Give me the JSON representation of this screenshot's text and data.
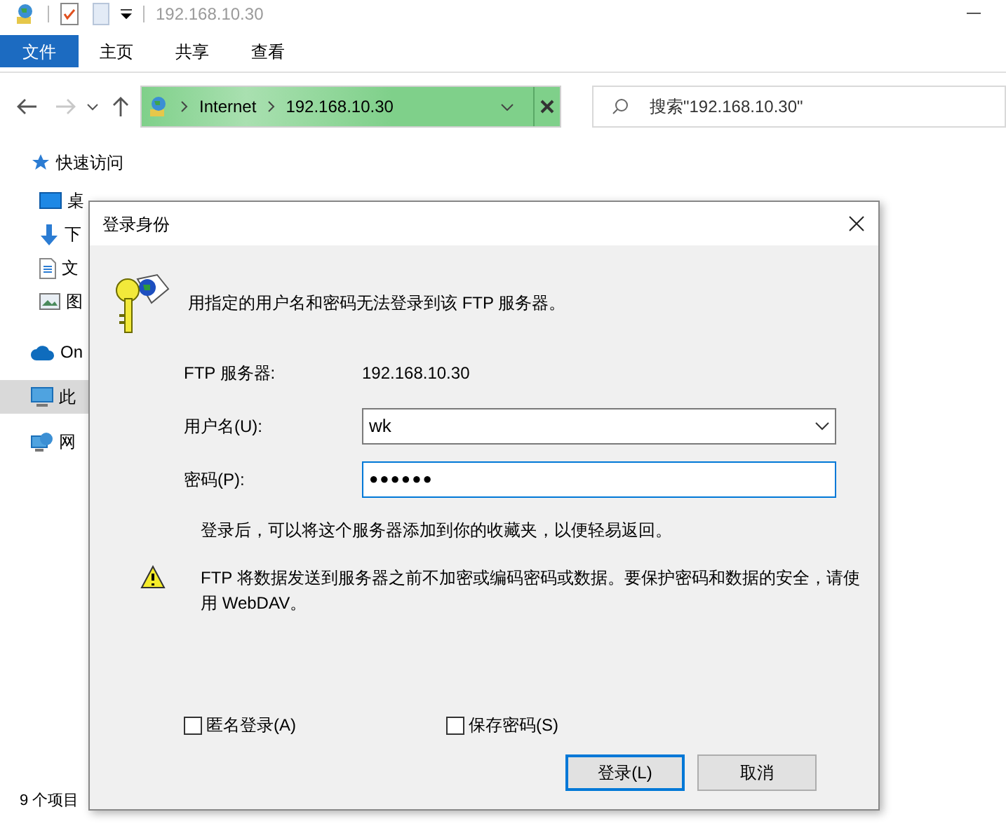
{
  "window": {
    "title": "192.168.10.30"
  },
  "ribbon_tabs": [
    {
      "label": "文件",
      "kind": "file"
    },
    {
      "label": "主页",
      "kind": "tab"
    },
    {
      "label": "共享",
      "kind": "tab"
    },
    {
      "label": "查看",
      "kind": "tab"
    }
  ],
  "address_bar": {
    "path": [
      "Internet",
      "192.168.10.30"
    ]
  },
  "search": {
    "placeholder": "搜索\"192.168.10.30\""
  },
  "sidebar": {
    "items": [
      {
        "label": "快速访问",
        "kind": "star",
        "selected": false
      },
      {
        "label": "桌",
        "kind": "desktop",
        "selected": false
      },
      {
        "label": "下",
        "kind": "download",
        "selected": false
      },
      {
        "label": "文",
        "kind": "document",
        "selected": false
      },
      {
        "label": "图",
        "kind": "picture",
        "selected": false
      },
      {
        "label": "On",
        "kind": "cloud",
        "selected": false
      },
      {
        "label": "此",
        "kind": "pc",
        "selected": true
      },
      {
        "label": "网",
        "kind": "network",
        "selected": false
      }
    ]
  },
  "status_bar": {
    "text": "9 个项目"
  },
  "dialog": {
    "title": "登录身份",
    "message": "用指定的用户名和密码无法登录到该 FTP 服务器。",
    "fields": [
      {
        "label": "FTP 服务器:",
        "kind": "static",
        "value": "192.168.10.30"
      },
      {
        "label": "用户名(U):",
        "kind": "combo",
        "value": "wk"
      },
      {
        "label": "密码(P):",
        "kind": "password",
        "value": "●●●●●●",
        "focused": true
      }
    ],
    "hint": "登录后，可以将这个服务器添加到你的收藏夹，以便轻易返回。",
    "warning": "FTP 将数据发送到服务器之前不加密或编码密码或数据。要保护密码和数据的安全，请使用 WebDAV。",
    "checkboxes": [
      {
        "label": "匿名登录(A)",
        "checked": false
      },
      {
        "label": "保存密码(S)",
        "checked": false
      }
    ],
    "buttons": [
      {
        "label": "登录(L)",
        "default": true
      },
      {
        "label": "取消",
        "default": false
      }
    ]
  }
}
